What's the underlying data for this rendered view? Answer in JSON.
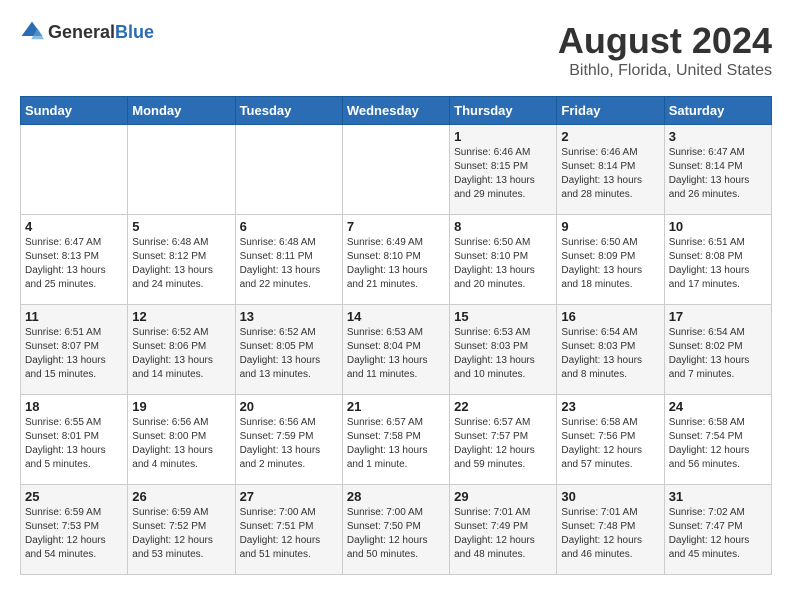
{
  "logo": {
    "general": "General",
    "blue": "Blue"
  },
  "title": "August 2024",
  "subtitle": "Bithlo, Florida, United States",
  "headers": [
    "Sunday",
    "Monday",
    "Tuesday",
    "Wednesday",
    "Thursday",
    "Friday",
    "Saturday"
  ],
  "weeks": [
    [
      {
        "day": "",
        "info": ""
      },
      {
        "day": "",
        "info": ""
      },
      {
        "day": "",
        "info": ""
      },
      {
        "day": "",
        "info": ""
      },
      {
        "day": "1",
        "info": "Sunrise: 6:46 AM\nSunset: 8:15 PM\nDaylight: 13 hours\nand 29 minutes."
      },
      {
        "day": "2",
        "info": "Sunrise: 6:46 AM\nSunset: 8:14 PM\nDaylight: 13 hours\nand 28 minutes."
      },
      {
        "day": "3",
        "info": "Sunrise: 6:47 AM\nSunset: 8:14 PM\nDaylight: 13 hours\nand 26 minutes."
      }
    ],
    [
      {
        "day": "4",
        "info": "Sunrise: 6:47 AM\nSunset: 8:13 PM\nDaylight: 13 hours\nand 25 minutes."
      },
      {
        "day": "5",
        "info": "Sunrise: 6:48 AM\nSunset: 8:12 PM\nDaylight: 13 hours\nand 24 minutes."
      },
      {
        "day": "6",
        "info": "Sunrise: 6:48 AM\nSunset: 8:11 PM\nDaylight: 13 hours\nand 22 minutes."
      },
      {
        "day": "7",
        "info": "Sunrise: 6:49 AM\nSunset: 8:10 PM\nDaylight: 13 hours\nand 21 minutes."
      },
      {
        "day": "8",
        "info": "Sunrise: 6:50 AM\nSunset: 8:10 PM\nDaylight: 13 hours\nand 20 minutes."
      },
      {
        "day": "9",
        "info": "Sunrise: 6:50 AM\nSunset: 8:09 PM\nDaylight: 13 hours\nand 18 minutes."
      },
      {
        "day": "10",
        "info": "Sunrise: 6:51 AM\nSunset: 8:08 PM\nDaylight: 13 hours\nand 17 minutes."
      }
    ],
    [
      {
        "day": "11",
        "info": "Sunrise: 6:51 AM\nSunset: 8:07 PM\nDaylight: 13 hours\nand 15 minutes."
      },
      {
        "day": "12",
        "info": "Sunrise: 6:52 AM\nSunset: 8:06 PM\nDaylight: 13 hours\nand 14 minutes."
      },
      {
        "day": "13",
        "info": "Sunrise: 6:52 AM\nSunset: 8:05 PM\nDaylight: 13 hours\nand 13 minutes."
      },
      {
        "day": "14",
        "info": "Sunrise: 6:53 AM\nSunset: 8:04 PM\nDaylight: 13 hours\nand 11 minutes."
      },
      {
        "day": "15",
        "info": "Sunrise: 6:53 AM\nSunset: 8:03 PM\nDaylight: 13 hours\nand 10 minutes."
      },
      {
        "day": "16",
        "info": "Sunrise: 6:54 AM\nSunset: 8:03 PM\nDaylight: 13 hours\nand 8 minutes."
      },
      {
        "day": "17",
        "info": "Sunrise: 6:54 AM\nSunset: 8:02 PM\nDaylight: 13 hours\nand 7 minutes."
      }
    ],
    [
      {
        "day": "18",
        "info": "Sunrise: 6:55 AM\nSunset: 8:01 PM\nDaylight: 13 hours\nand 5 minutes."
      },
      {
        "day": "19",
        "info": "Sunrise: 6:56 AM\nSunset: 8:00 PM\nDaylight: 13 hours\nand 4 minutes."
      },
      {
        "day": "20",
        "info": "Sunrise: 6:56 AM\nSunset: 7:59 PM\nDaylight: 13 hours\nand 2 minutes."
      },
      {
        "day": "21",
        "info": "Sunrise: 6:57 AM\nSunset: 7:58 PM\nDaylight: 13 hours\nand 1 minute."
      },
      {
        "day": "22",
        "info": "Sunrise: 6:57 AM\nSunset: 7:57 PM\nDaylight: 12 hours\nand 59 minutes."
      },
      {
        "day": "23",
        "info": "Sunrise: 6:58 AM\nSunset: 7:56 PM\nDaylight: 12 hours\nand 57 minutes."
      },
      {
        "day": "24",
        "info": "Sunrise: 6:58 AM\nSunset: 7:54 PM\nDaylight: 12 hours\nand 56 minutes."
      }
    ],
    [
      {
        "day": "25",
        "info": "Sunrise: 6:59 AM\nSunset: 7:53 PM\nDaylight: 12 hours\nand 54 minutes."
      },
      {
        "day": "26",
        "info": "Sunrise: 6:59 AM\nSunset: 7:52 PM\nDaylight: 12 hours\nand 53 minutes."
      },
      {
        "day": "27",
        "info": "Sunrise: 7:00 AM\nSunset: 7:51 PM\nDaylight: 12 hours\nand 51 minutes."
      },
      {
        "day": "28",
        "info": "Sunrise: 7:00 AM\nSunset: 7:50 PM\nDaylight: 12 hours\nand 50 minutes."
      },
      {
        "day": "29",
        "info": "Sunrise: 7:01 AM\nSunset: 7:49 PM\nDaylight: 12 hours\nand 48 minutes."
      },
      {
        "day": "30",
        "info": "Sunrise: 7:01 AM\nSunset: 7:48 PM\nDaylight: 12 hours\nand 46 minutes."
      },
      {
        "day": "31",
        "info": "Sunrise: 7:02 AM\nSunset: 7:47 PM\nDaylight: 12 hours\nand 45 minutes."
      }
    ]
  ]
}
